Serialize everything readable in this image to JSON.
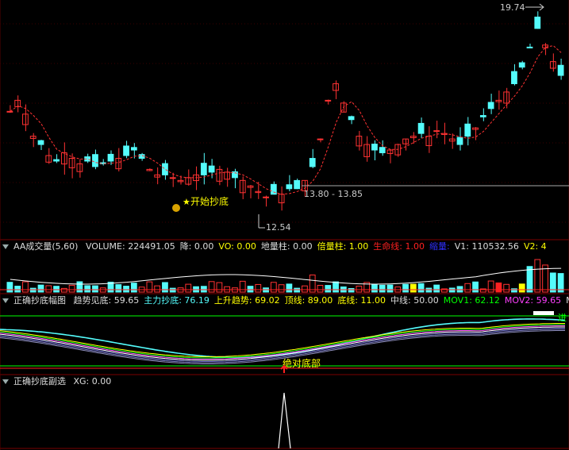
{
  "colors": {
    "background": "#000000",
    "up": "#ff3232",
    "down": "#54fcfc",
    "ma": "#ff3232",
    "yellow": "#ffff00",
    "green": "#00ff00",
    "white": "#ffffff",
    "panel_border": "#7a0000"
  },
  "main_panel": {
    "high_label": "19.74",
    "low_label": "12.54",
    "range_label": "13.80 - 13.85",
    "signal_label": "开始抄底",
    "star_icon": "★",
    "coin_icon": "money-bag-icon"
  },
  "volume_panel": {
    "title": "AA成交量(5,60)",
    "values": [
      {
        "label": "VOLUME:",
        "value": "224491.05",
        "color": "#dddddd"
      },
      {
        "label": "降:",
        "value": "0.00",
        "color": "#dddddd"
      },
      {
        "label": "VO:",
        "value": "0.00",
        "color": "#ffff00"
      },
      {
        "label": "地量柱:",
        "value": "0.00",
        "color": "#dddddd"
      },
      {
        "label": "倍量柱:",
        "value": "1.00",
        "color": "#ffff00"
      },
      {
        "label": "生命线:",
        "value": "1.00",
        "color": "#ff2020"
      },
      {
        "label": "缩量:",
        "value": "",
        "color": "#3030ff"
      },
      {
        "label": "V1:",
        "value": "110532.56",
        "color": "#dddddd"
      },
      {
        "label": "V2:",
        "value": "4",
        "color": "#ffff00"
      }
    ]
  },
  "oscillator_panel": {
    "title": "正确抄底幅图",
    "values": [
      {
        "label": "趋势见底:",
        "value": "59.65",
        "color": "#dddddd"
      },
      {
        "label": "主力抄底:",
        "value": "76.19",
        "color": "#54fcfc"
      },
      {
        "label": "上升趋势:",
        "value": "69.02",
        "color": "#ffff00"
      },
      {
        "label": "顶线:",
        "value": "89.00",
        "color": "#ffff00"
      },
      {
        "label": "底线:",
        "value": "11.00",
        "color": "#ffff00"
      },
      {
        "label": "中线:",
        "value": "50.00",
        "color": "#dddddd"
      },
      {
        "label": "MOV1:",
        "value": "62.12",
        "color": "#00ff00"
      },
      {
        "label": "MOV2:",
        "value": "59.65",
        "color": "#ff40ff"
      },
      {
        "label": "M",
        "value": "",
        "color": "#dddddd"
      }
    ],
    "bottom_label": "绝对底部",
    "entry_label": "进"
  },
  "signal_panel": {
    "title": "正确抄底副选",
    "values": [
      {
        "label": "XG:",
        "value": "0.00",
        "color": "#dddddd"
      }
    ]
  }
}
